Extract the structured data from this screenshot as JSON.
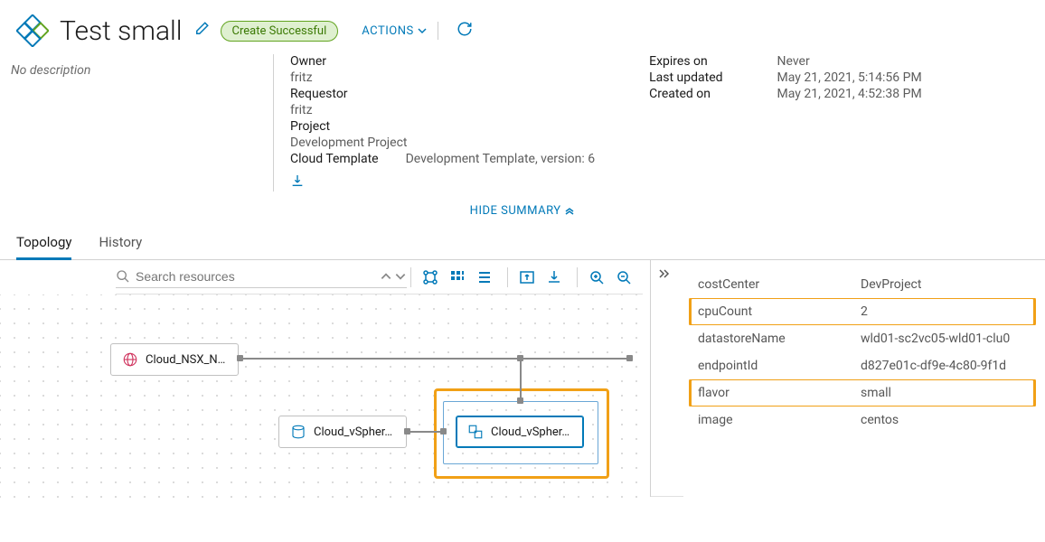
{
  "header": {
    "title": "Test small",
    "status": "Create Successful",
    "actions_label": "ACTIONS"
  },
  "description": "No description",
  "summary": {
    "owner_label": "Owner",
    "owner": "fritz",
    "requestor_label": "Requestor",
    "requestor": "fritz",
    "project_label": "Project",
    "project": "Development Project",
    "template_label": "Cloud Template",
    "template": "Development Template, version: 6",
    "expires_label": "Expires on",
    "expires": "Never",
    "updated_label": "Last updated",
    "updated": "May 21, 2021, 5:14:56 PM",
    "created_label": "Created on",
    "created": "May 21, 2021, 4:52:38 PM"
  },
  "hide_summary": "HIDE SUMMARY",
  "tabs": {
    "topology": "Topology",
    "history": "History"
  },
  "search": {
    "placeholder": "Search resources"
  },
  "nodes": {
    "nsx": "Cloud_NSX_N…",
    "disk": "Cloud_vSpher…",
    "vm": "Cloud_vSpher…"
  },
  "properties": [
    {
      "k": "costCenter",
      "v": "DevProject"
    },
    {
      "k": "cpuCount",
      "v": "2"
    },
    {
      "k": "datastoreName",
      "v": "wld01-sc2vc05-wld01-clu0"
    },
    {
      "k": "endpointId",
      "v": "d827e01c-df9e-4c80-9f1d"
    },
    {
      "k": "flavor",
      "v": "small"
    },
    {
      "k": "image",
      "v": "centos"
    }
  ]
}
